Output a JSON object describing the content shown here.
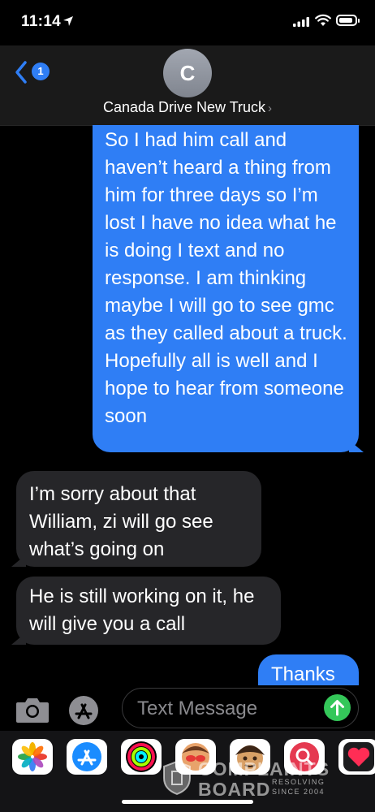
{
  "status_bar": {
    "time": "11:14"
  },
  "header": {
    "back_badge": "1",
    "avatar_initial": "C",
    "contact_name": "Canada Drive New Truck"
  },
  "messages": [
    {
      "from": "me",
      "text": "So I had him call and haven’t heard a thing from him for three days so I’m lost I have no idea what he is doing I text and no response. I am thinking maybe I will go to see gmc as they called about a truck. Hopefully all is well and I hope to hear from someone soon"
    },
    {
      "from": "them",
      "text": "I’m sorry about that William, zi will go see what’s going on"
    },
    {
      "from": "them",
      "text": "He is still working on it, he will give you a call"
    },
    {
      "from": "me",
      "text": "Thanks"
    }
  ],
  "input": {
    "placeholder": "Text Message"
  },
  "app_tray": [
    "photos-app",
    "app-store-app",
    "activity-app",
    "memoji-stickers-app",
    "animoji-app",
    "search-images-app",
    "digital-touch-app"
  ],
  "watermark": {
    "line1": "COMPLAINTS",
    "line2": "BOARD",
    "line3": "RESOLVING",
    "line4": "SINCE 2004"
  },
  "colors": {
    "sent_bubble": "#2f7ef5",
    "received_bubble": "#262629",
    "send_button": "#34c759"
  }
}
